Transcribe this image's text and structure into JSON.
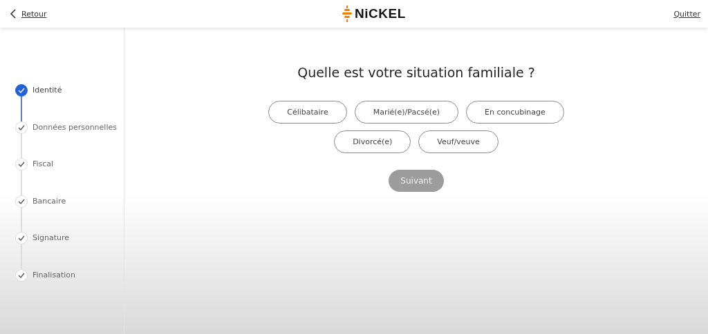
{
  "header": {
    "back_link": "Retour",
    "logo": "NiCKEL",
    "quit_link": "Quitter"
  },
  "steps": [
    {
      "label": "Identité",
      "selected": true
    },
    {
      "label": "Données personnelles",
      "selected": false
    },
    {
      "label": "Fiscal",
      "selected": false
    },
    {
      "label": "Bancaire",
      "selected": false
    },
    {
      "label": "Signature",
      "selected": false
    },
    {
      "label": "Finalisation",
      "selected": false
    }
  ],
  "question": "Quelle est votre situation familiale ?",
  "options": [
    {
      "label": "Célibataire",
      "selected": false
    },
    {
      "label": "Marié(e)/Pacsé(e)",
      "selected": false
    },
    {
      "label": "En concubinage",
      "selected": false
    },
    {
      "label": "Divorcé(e)",
      "selected": false
    },
    {
      "label": "Veuf/veuve",
      "selected": false
    }
  ],
  "next_button": {
    "label": "Suivant",
    "disabled": true
  }
}
